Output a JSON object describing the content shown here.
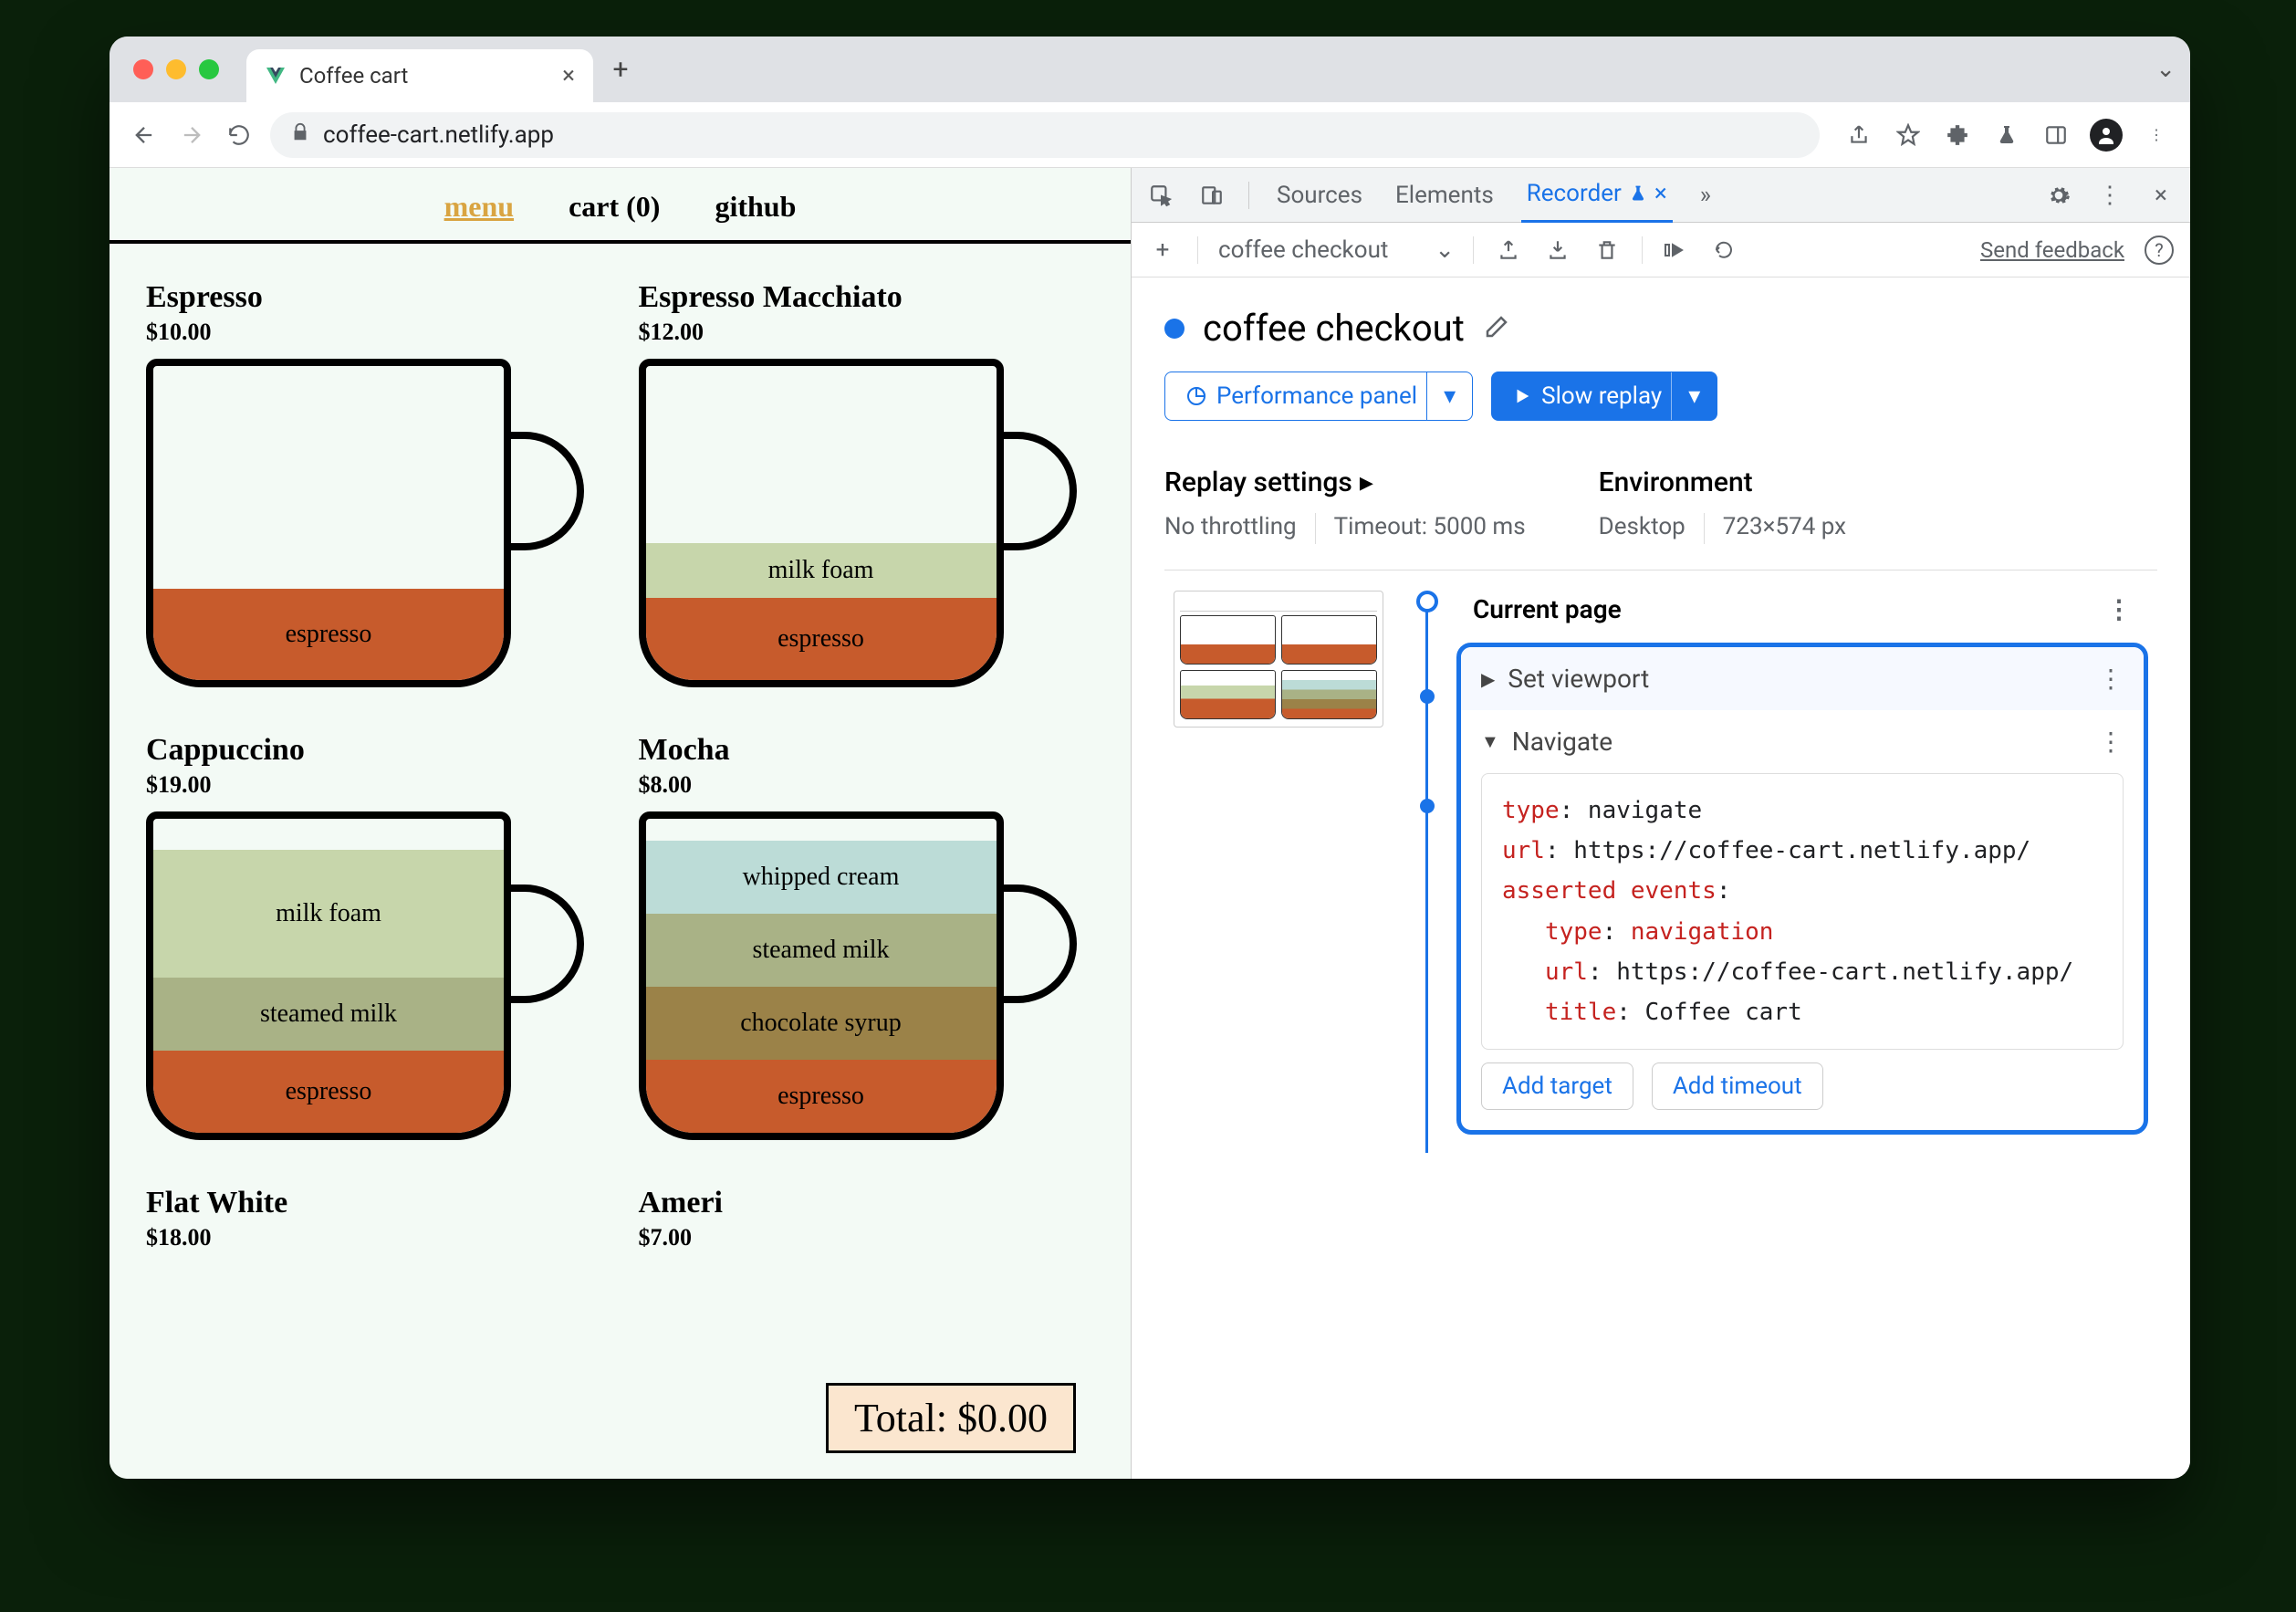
{
  "browser": {
    "tab_title": "Coffee cart",
    "url": "coffee-cart.netlify.app"
  },
  "page": {
    "nav": {
      "menu": "menu",
      "cart": "cart (0)",
      "github": "github"
    },
    "products": [
      {
        "name": "Espresso",
        "price": "$10.00"
      },
      {
        "name": "Espresso Macchiato",
        "price": "$12.00"
      },
      {
        "name": "Cappuccino",
        "price": "$19.00"
      },
      {
        "name": "Mocha",
        "price": "$8.00"
      },
      {
        "name": "Flat White",
        "price": "$18.00"
      },
      {
        "name": "Americano",
        "price": "$7.00"
      }
    ],
    "layers": {
      "espresso": "espresso",
      "milkfoam": "milk foam",
      "steamed": "steamed milk",
      "choco": "chocolate syrup",
      "whip": "whipped cream"
    },
    "total": "Total: $0.00"
  },
  "devtools": {
    "tabs": {
      "sources": "Sources",
      "elements": "Elements",
      "recorder": "Recorder"
    },
    "toolbar": {
      "recording_name": "coffee checkout",
      "feedback": "Send feedback"
    },
    "recording_title": "coffee checkout",
    "perf_btn": "Performance panel",
    "replay_btn": "Slow replay",
    "replay_settings": {
      "title": "Replay settings",
      "throttle": "No throttling",
      "timeout": "Timeout: 5000 ms"
    },
    "environment": {
      "title": "Environment",
      "device": "Desktop",
      "viewport": "723×574 px"
    },
    "steps": {
      "current": "Current page",
      "setviewport": "Set viewport",
      "navigate": "Navigate",
      "code": {
        "l1a": "type",
        "l1b": ": navigate",
        "l2a": "url",
        "l2b": ": https://coffee-cart.netlify.app/",
        "l3a": "asserted events",
        "l3b": ":",
        "l4a": "type",
        "l4b": ": ",
        "l4c": "navigation",
        "l5a": "url",
        "l5b": ": https://coffee-cart.netlify.app/",
        "l6a": "title",
        "l6b": ": Coffee cart"
      },
      "add_target": "Add target",
      "add_timeout": "Add timeout"
    }
  }
}
